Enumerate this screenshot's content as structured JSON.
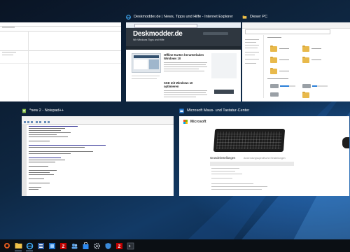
{
  "task_view": {
    "windows": [
      {
        "id": "left-partial",
        "title": ""
      },
      {
        "id": "internet-explorer",
        "title": "Deskmodder.de | News, Tipps und Hilfe - Internet Explorer",
        "app_icon": "ie-icon"
      },
      {
        "id": "file-explorer",
        "title": "Dieser PC",
        "app_icon": "file-explorer-icon"
      },
      {
        "id": "notepad-plus",
        "title": "*new 2 - Notepad++",
        "app_icon": "notepad-plus-icon"
      },
      {
        "id": "mouse-keyboard-center",
        "title": "Microsoft Maus- und Tastatur-Center",
        "app_icon": "mouse-keyboard-center-icon"
      }
    ]
  },
  "ie_content": {
    "logo": "Deskmodder.de",
    "tagline": "Wir Windows Tipps und Hilfe",
    "headline_1": "Offline-Karten herunterladen Windows 10",
    "headline_2": "SSD mit Windows 10 optimieren"
  },
  "mk_content": {
    "brand": "Microsoft",
    "section_title": "Grundeinstellungen",
    "tab_label": "Anwendungsspezifische Einstellungen"
  },
  "taskbar": {
    "items": [
      {
        "name": "start-button",
        "icon": "start-icon"
      },
      {
        "name": "explorer",
        "icon": "folder-icon"
      },
      {
        "name": "ie",
        "icon": "ie-icon"
      },
      {
        "name": "word",
        "icon": "word-icon"
      },
      {
        "name": "app-blue",
        "icon": "app-icon"
      },
      {
        "name": "filezilla",
        "icon": "filezilla-icon"
      },
      {
        "name": "app-people",
        "icon": "people-icon"
      },
      {
        "name": "app-store",
        "icon": "store-icon"
      },
      {
        "name": "app-gear",
        "icon": "gear-icon"
      },
      {
        "name": "app-shield",
        "icon": "shield-icon"
      },
      {
        "name": "filezilla-2",
        "icon": "filezilla-icon"
      },
      {
        "name": "app-dark",
        "icon": "terminal-icon"
      }
    ]
  },
  "colors": {
    "accent": "#2a7fd8",
    "taskbar": "#0b0f14",
    "start": "#e35b1e"
  }
}
